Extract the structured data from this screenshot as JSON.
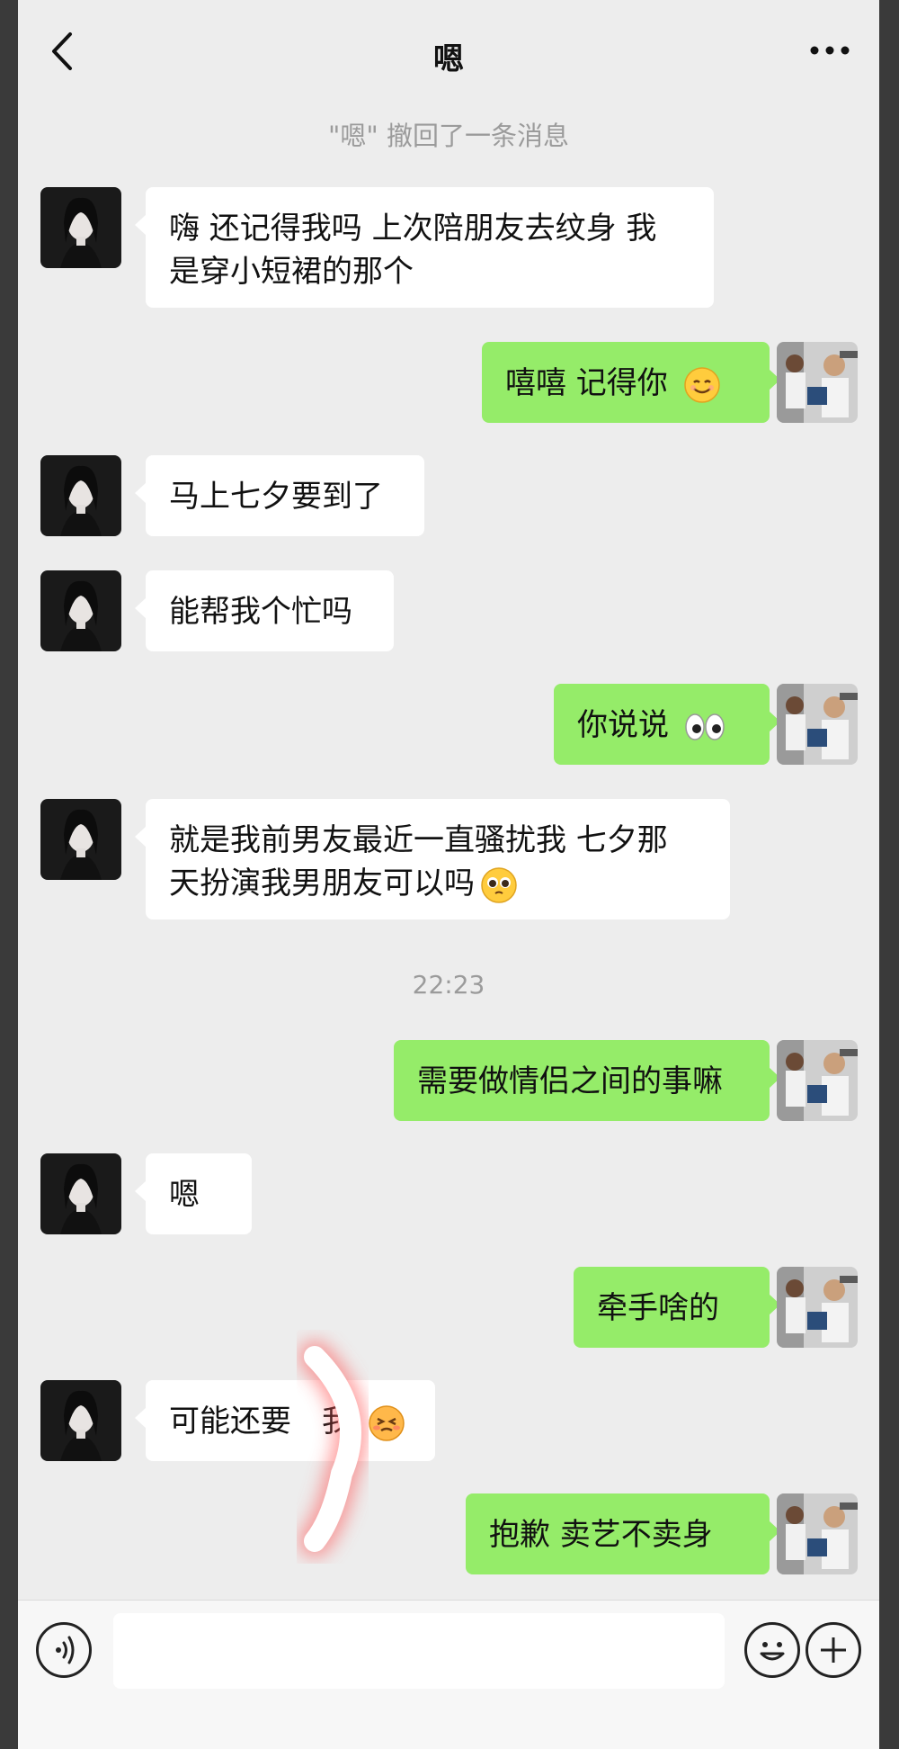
{
  "header": {
    "title": "嗯"
  },
  "system_note": "\"嗯\" 撤回了一条消息",
  "time_divider": "22:23",
  "messages": [
    {
      "dir": "in",
      "text_l1": "嗨 还记得我吗 上次陪朋友去纹身 我",
      "text_l2": "是穿小短裙的那个"
    },
    {
      "dir": "out",
      "text": "嘻嘻 记得你",
      "emoji": "smiling-face-emoji"
    },
    {
      "dir": "in",
      "text": "马上七夕要到了"
    },
    {
      "dir": "in",
      "text": "能帮我个忙吗"
    },
    {
      "dir": "out",
      "text": "你说说",
      "emoji": "eyes-emoji"
    },
    {
      "dir": "in",
      "text_l1": "就是我前男友最近一直骚扰我 七夕那",
      "text_l2": "天扮演我男朋友可以吗",
      "emoji": "pleading-face-emoji"
    },
    {
      "dir": "out",
      "text": "需要做情侣之间的事嘛"
    },
    {
      "dir": "in",
      "text": "嗯"
    },
    {
      "dir": "out",
      "text": "牵手啥的"
    },
    {
      "dir": "in",
      "text": "可能还要",
      "text_after": "我",
      "emoji": "shy-face-emoji"
    },
    {
      "dir": "out",
      "text": "抱歉 卖艺不卖身"
    }
  ],
  "colors": {
    "background": "#ededed",
    "incoming_bubble": "#ffffff",
    "outgoing_bubble": "#95ec69",
    "meta_text": "#9b9b9b"
  },
  "bottom_bar": {
    "icons": [
      "voice-icon",
      "emoji-icon",
      "plus-icon"
    ]
  }
}
